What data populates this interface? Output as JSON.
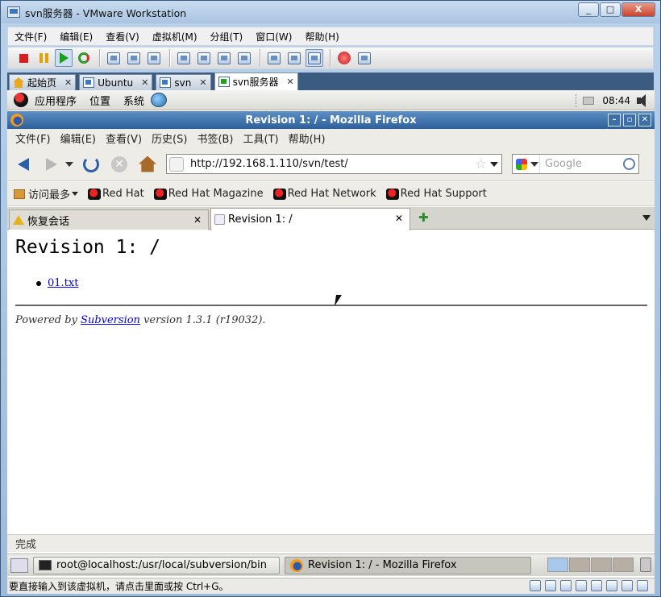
{
  "vmware": {
    "title": "svn服务器 - VMware Workstation",
    "window_controls": [
      "_",
      "□",
      "X"
    ],
    "menu": [
      "文件(F)",
      "编辑(E)",
      "查看(V)",
      "虚拟机(M)",
      "分组(T)",
      "窗口(W)",
      "帮助(H)"
    ],
    "tabs": [
      {
        "label": "起始页",
        "icon": "home-icon"
      },
      {
        "label": "Ubuntu",
        "icon": "vm-icon"
      },
      {
        "label": "svn",
        "icon": "vm-icon"
      },
      {
        "label": "svn服务器",
        "icon": "vm-running-icon",
        "active": true
      }
    ],
    "status_text": "要直接输入到该虚拟机，请点击里面或按 Ctrl+G。"
  },
  "gnome": {
    "menus": [
      "应用程序",
      "位置",
      "系统"
    ],
    "clock": "08:44",
    "taskbar": [
      {
        "label": "root@localhost:/usr/local/subversion/bin",
        "icon": "terminal-icon"
      },
      {
        "label": "Revision 1: / - Mozilla Firefox",
        "icon": "firefox-icon",
        "active": true
      }
    ]
  },
  "firefox": {
    "title": "Revision 1: / - Mozilla Firefox",
    "menu": [
      "文件(F)",
      "编辑(E)",
      "查看(V)",
      "历史(S)",
      "书签(B)",
      "工具(T)",
      "帮助(H)"
    ],
    "url": "http://192.168.1.110/svn/test/",
    "search_placeholder": "Google",
    "bookmarks": [
      "访问最多",
      "Red Hat",
      "Red Hat Magazine",
      "Red Hat Network",
      "Red Hat Support"
    ],
    "tabs": [
      {
        "label": "恢复会话",
        "icon": "warning-icon"
      },
      {
        "label": "Revision 1: /",
        "icon": "page-icon",
        "active": true
      }
    ],
    "new_tab_symbol": "✚",
    "status": "完成"
  },
  "page": {
    "heading": "Revision 1: /",
    "files": [
      "01.txt"
    ],
    "powered_prefix": "Powered by",
    "powered_link": "Subversion",
    "powered_suffix": "version 1.3.1 (r19032)."
  }
}
